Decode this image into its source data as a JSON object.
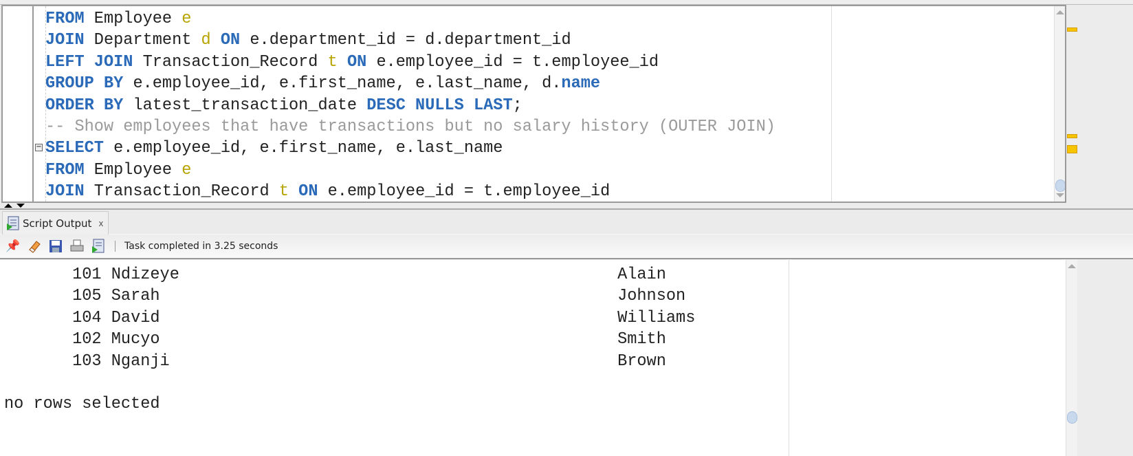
{
  "editor": {
    "lines": [
      [
        {
          "t": "FROM",
          "c": "kw"
        },
        {
          "t": " Employee "
        },
        {
          "t": "e",
          "c": "al"
        }
      ],
      [
        {
          "t": "JOIN",
          "c": "kw"
        },
        {
          "t": " Department "
        },
        {
          "t": "d",
          "c": "al"
        },
        {
          "t": " "
        },
        {
          "t": "ON",
          "c": "kw"
        },
        {
          "t": " e.department_id = d.department_id"
        }
      ],
      [
        {
          "t": "LEFT JOIN",
          "c": "kw"
        },
        {
          "t": " Transaction_Record "
        },
        {
          "t": "t",
          "c": "al"
        },
        {
          "t": " "
        },
        {
          "t": "ON",
          "c": "kw"
        },
        {
          "t": " e.employee_id = t.employee_id"
        }
      ],
      [
        {
          "t": "GROUP BY",
          "c": "kw"
        },
        {
          "t": " e.employee_id, e.first_name, e.last_name, d."
        },
        {
          "t": "name",
          "c": "kw"
        }
      ],
      [
        {
          "t": "ORDER BY",
          "c": "kw"
        },
        {
          "t": " latest_transaction_date "
        },
        {
          "t": "DESC NULLS LAST",
          "c": "kw"
        },
        {
          "t": ";"
        }
      ],
      [
        {
          "t": "-- Show employees that have transactions but no salary history (OUTER JOIN)",
          "c": "cm"
        }
      ],
      [
        {
          "t": "SELECT",
          "c": "kw"
        },
        {
          "t": " e.employee_id, e.first_name, e.last_name"
        }
      ],
      [
        {
          "t": "FROM",
          "c": "kw"
        },
        {
          "t": " Employee "
        },
        {
          "t": "e",
          "c": "al"
        }
      ],
      [
        {
          "t": "JOIN",
          "c": "kw"
        },
        {
          "t": " Transaction_Record "
        },
        {
          "t": "t",
          "c": "al"
        },
        {
          "t": " "
        },
        {
          "t": "ON",
          "c": "kw"
        },
        {
          "t": " e.employee_id = t.employee_id"
        }
      ]
    ]
  },
  "output_panel": {
    "tab_label": "Script Output",
    "tab_close": "x",
    "status": "Task completed in 3.25 seconds",
    "toolbar_icons": [
      "pin-icon",
      "eraser-icon",
      "save-icon",
      "print-icon",
      "export-icon"
    ],
    "rows": [
      {
        "id": "101",
        "first_name": "Ndizeye",
        "last_name": "Alain"
      },
      {
        "id": "105",
        "first_name": "Sarah",
        "last_name": "Johnson"
      },
      {
        "id": "104",
        "first_name": "David",
        "last_name": "Williams"
      },
      {
        "id": "102",
        "first_name": "Mucyo",
        "last_name": "Smith"
      },
      {
        "id": "103",
        "first_name": "Nganji",
        "last_name": "Brown"
      }
    ],
    "message": "no rows selected"
  },
  "colors": {
    "keyword": "#2a6ab8",
    "alias": "#b8a400",
    "comment": "#9a9a9a",
    "marker": "#f6c500"
  }
}
